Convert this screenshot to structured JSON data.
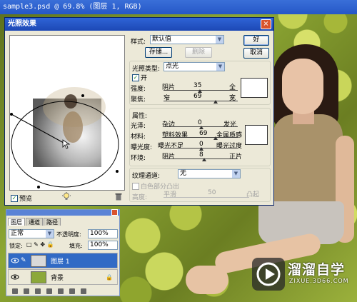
{
  "app": {
    "title": "sample3.psd @ 69.8% (图层 1, RGB)"
  },
  "dialog": {
    "title": "光照效果",
    "close_label": "×",
    "style_label": "样式:",
    "style_value": "默认值",
    "ok_label": "好",
    "cancel_label": "取消",
    "save_label": "存储...",
    "delete_label": "删除",
    "light_type_label": "光照类型:",
    "light_type_value": "点光",
    "on_label": "开",
    "on_checked": true,
    "intensity": {
      "label": "强度:",
      "left": "阴片",
      "value": "35",
      "right": "全"
    },
    "focus": {
      "label": "聚焦:",
      "left": "窄",
      "value": "69",
      "right": "宽"
    },
    "properties_label": "属性:",
    "gloss": {
      "label": "光泽:",
      "left": "杂边",
      "value": "0",
      "right": "发光"
    },
    "material": {
      "label": "材料:",
      "left": "塑料效果",
      "value": "69",
      "right": "金属质感"
    },
    "exposure": {
      "label": "曝光度:",
      "left": "曝光不足",
      "value": "0",
      "right": "曝光过度"
    },
    "ambience": {
      "label": "环境:",
      "left": "阴片",
      "value": "8",
      "right": "正片"
    },
    "texture_channel_label": "纹理通道:",
    "texture_channel_value": "无",
    "white_high_label": "白色部分凸出",
    "height": {
      "label": "高度:",
      "left": "平滑",
      "value": "50",
      "right": "凸起"
    },
    "preview_label": "预览",
    "preview_checked": true
  },
  "layers_panel": {
    "tabs": [
      "图层",
      "通道",
      "路径"
    ],
    "blend_mode": "正常",
    "opacity_label": "不透明度:",
    "opacity_value": "100%",
    "lock_label": "锁定:",
    "fill_label": "填充:",
    "fill_value": "100%",
    "layers": [
      {
        "name": "图层 1",
        "selected": true
      },
      {
        "name": "背景",
        "selected": false
      }
    ]
  },
  "watermark": {
    "text": "溜溜自学",
    "sub": "ZIXUE.3D66.COM"
  }
}
